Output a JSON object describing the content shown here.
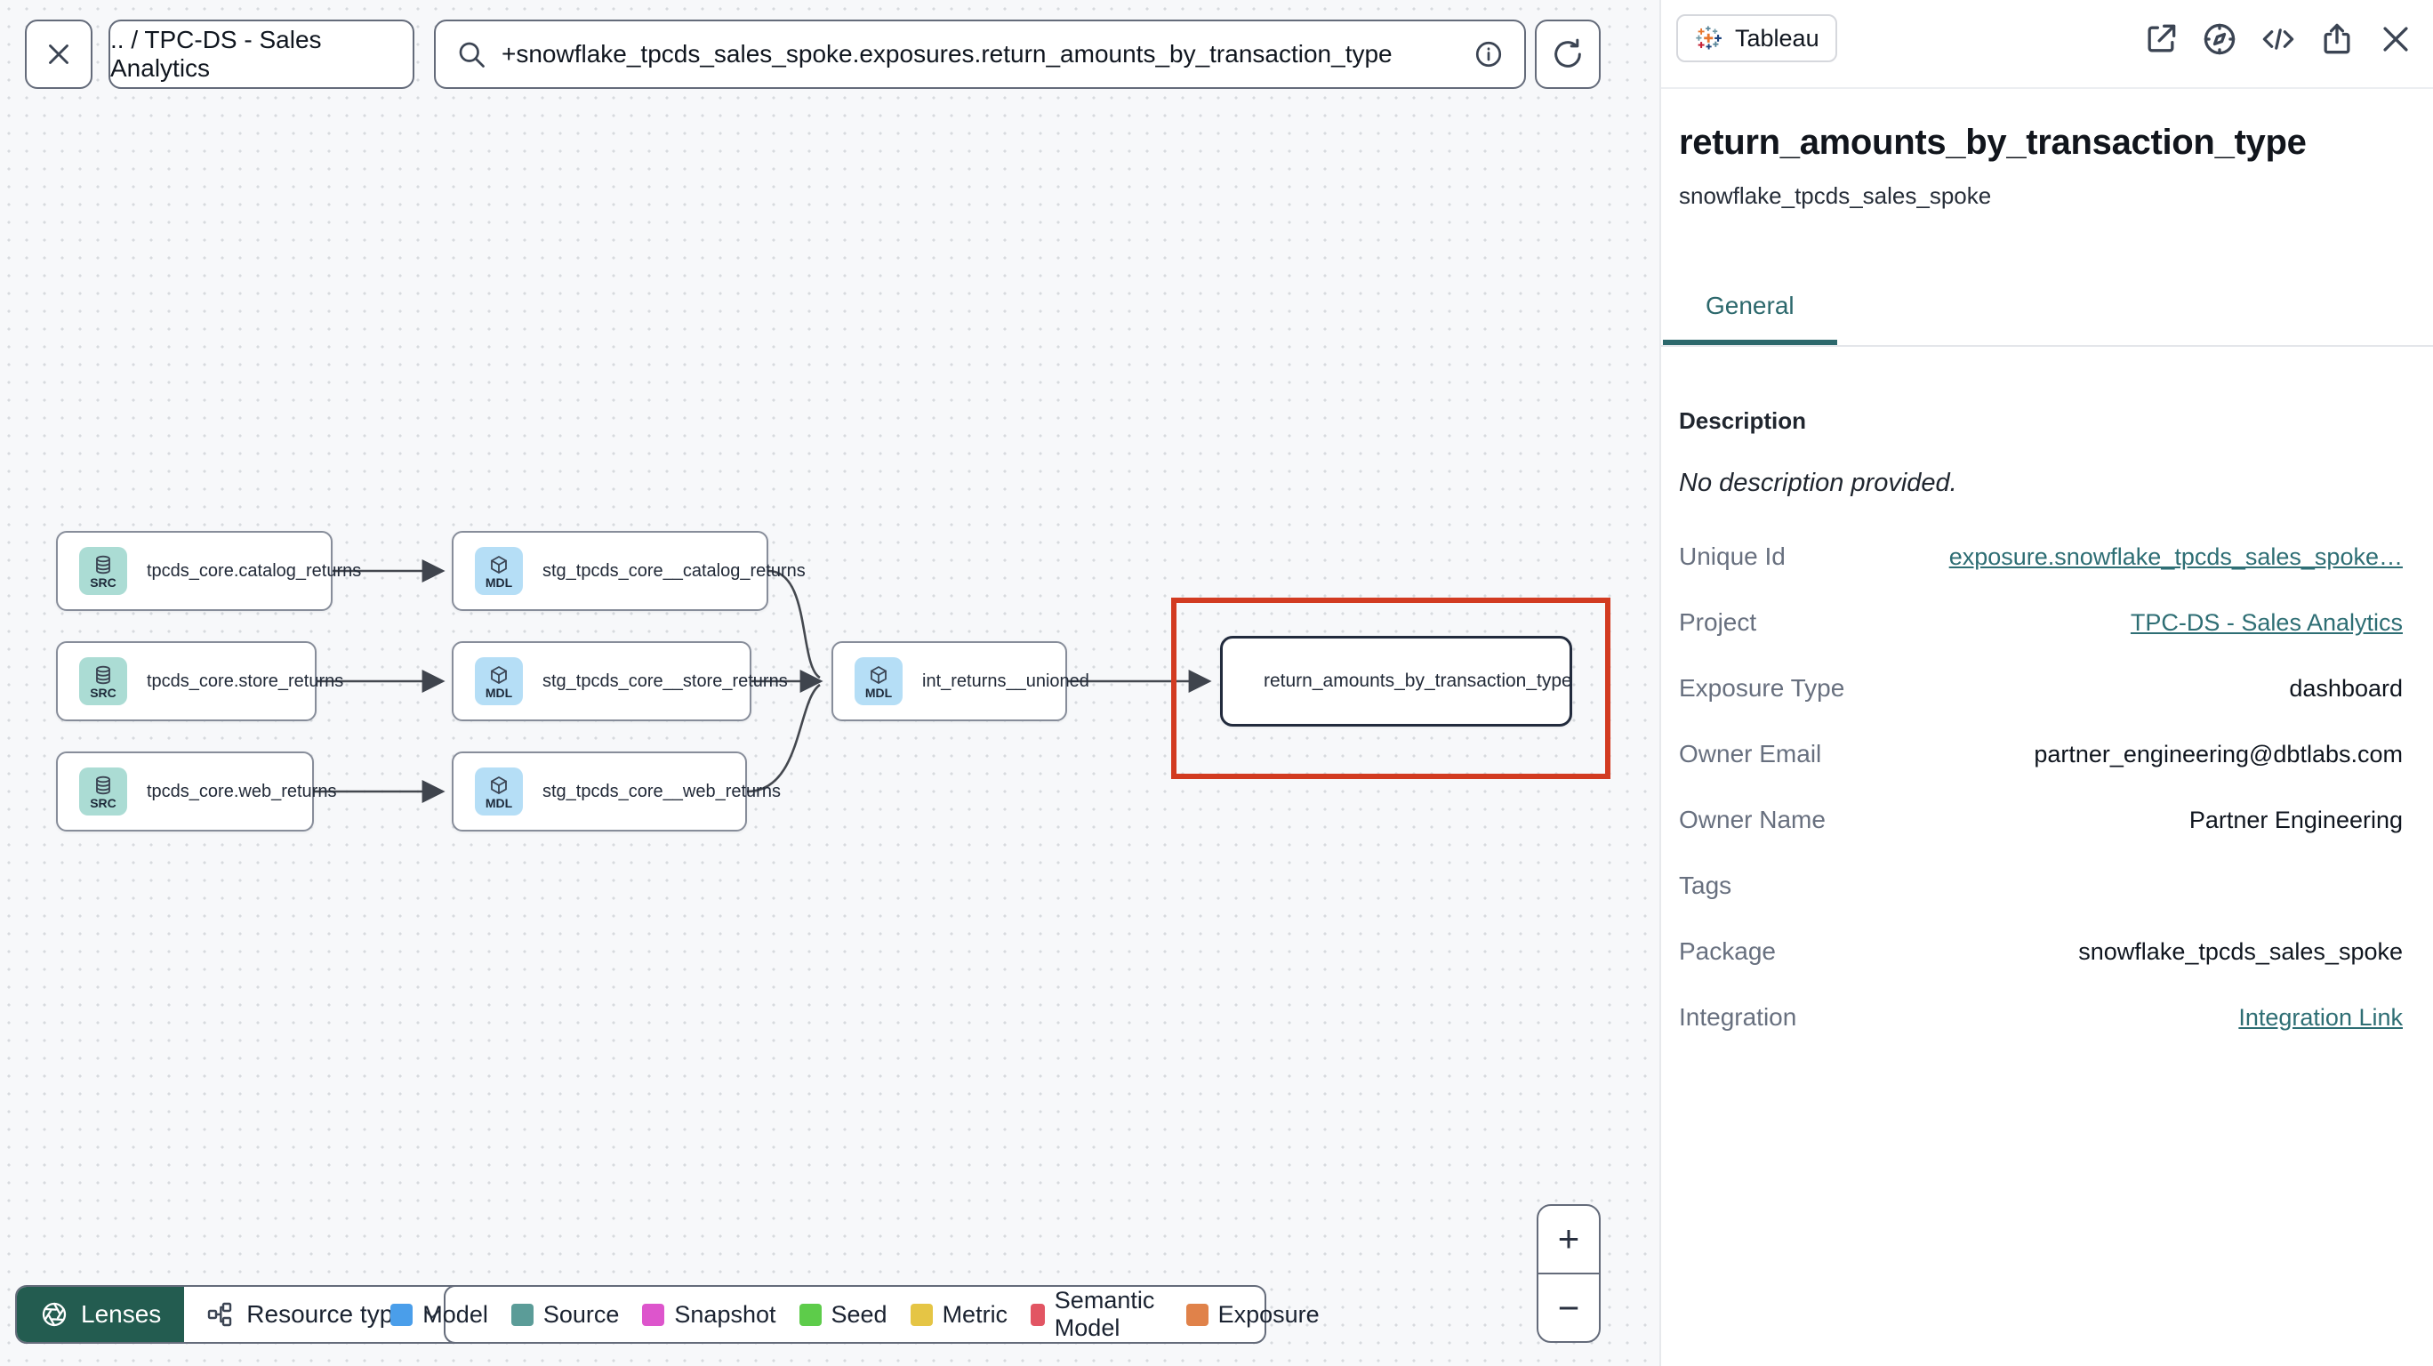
{
  "colors": {
    "accent_teal": "#2e6e74",
    "highlight_red": "#d23b21",
    "lenses_green": "#235c50",
    "badge_source": "#abdcd4",
    "badge_model": "#b5def6"
  },
  "toolbar": {
    "breadcrumb": ".. / TPC-DS - Sales Analytics",
    "search_value": "+snowflake_tpcds_sales_spoke.exposures.return_amounts_by_transaction_type"
  },
  "graph": {
    "nodes": [
      {
        "badge": "SRC",
        "label": "tpcds_core.catalog_returns"
      },
      {
        "badge": "SRC",
        "label": "tpcds_core.store_returns"
      },
      {
        "badge": "SRC",
        "label": "tpcds_core.web_returns"
      },
      {
        "badge": "MDL",
        "label": "stg_tpcds_core__catalog_returns"
      },
      {
        "badge": "MDL",
        "label": "stg_tpcds_core__store_returns"
      },
      {
        "badge": "MDL",
        "label": "stg_tpcds_core__web_returns"
      },
      {
        "badge": "MDL",
        "label": "int_returns__unioned"
      },
      {
        "badge": "tableau-logo",
        "label": "return_amounts_by_transaction_type"
      }
    ]
  },
  "controls": {
    "lenses_label": "Lenses",
    "resource_type_label": "Resource type",
    "zoom_in": "+",
    "zoom_out": "−"
  },
  "legend": {
    "items": [
      {
        "label": "Model",
        "color": "#4a9eea"
      },
      {
        "label": "Source",
        "color": "#5b9c98"
      },
      {
        "label": "Snapshot",
        "color": "#dd55cc"
      },
      {
        "label": "Seed",
        "color": "#5dcc4a"
      },
      {
        "label": "Metric",
        "color": "#e5c545"
      },
      {
        "label": "Semantic Model",
        "color": "#e25563"
      },
      {
        "label": "Exposure",
        "color": "#e0824a"
      }
    ]
  },
  "panel": {
    "tool_badge": "Tableau",
    "title": "return_amounts_by_transaction_type",
    "subtitle": "snowflake_tpcds_sales_spoke",
    "tabs": [
      {
        "label": "General"
      }
    ],
    "description": {
      "label": "Description",
      "value": "No description provided."
    },
    "rows": [
      {
        "label": "Unique Id",
        "value": "exposure.snowflake_tpcds_sales_spoke…"
      },
      {
        "label": "Project",
        "value": "TPC-DS - Sales Analytics"
      },
      {
        "label": "Exposure Type",
        "value": "dashboard"
      },
      {
        "label": "Owner Email",
        "value": "partner_engineering@dbtlabs.com"
      },
      {
        "label": "Owner Name",
        "value": "Partner Engineering"
      },
      {
        "label": "Tags",
        "value": ""
      },
      {
        "label": "Package",
        "value": "snowflake_tpcds_sales_spoke"
      },
      {
        "label": "Integration",
        "value": "Integration Link"
      }
    ]
  }
}
